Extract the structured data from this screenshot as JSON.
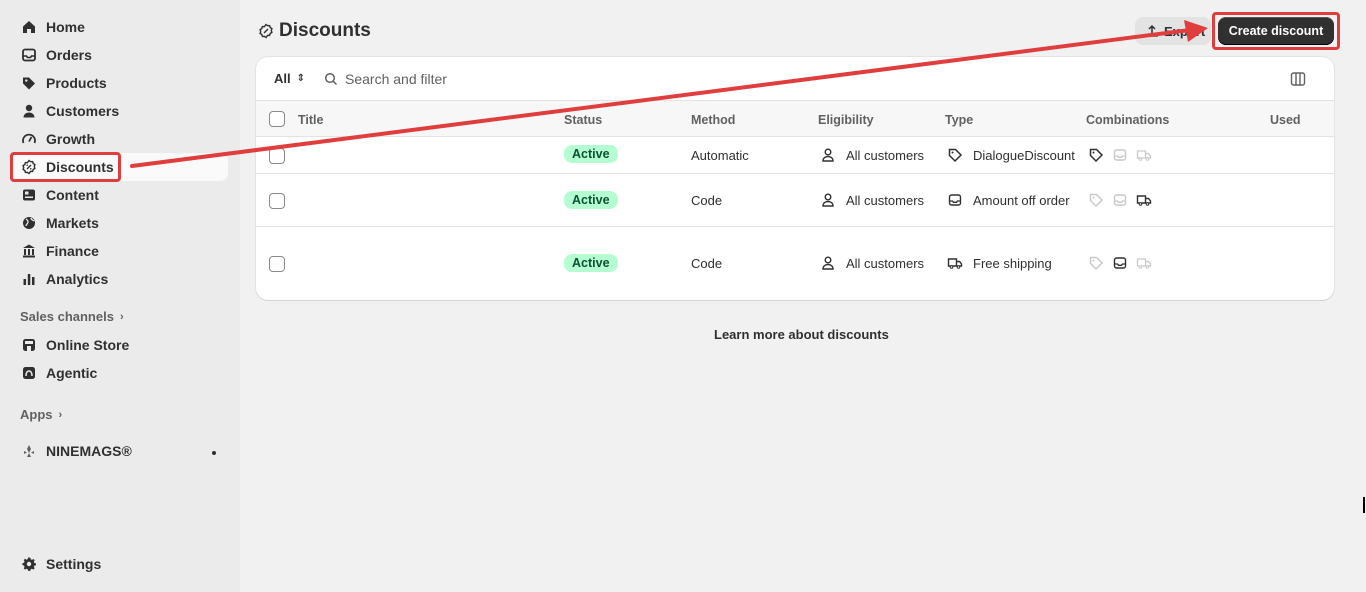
{
  "sidebar": {
    "items": [
      {
        "label": "Home",
        "icon": "home-icon"
      },
      {
        "label": "Orders",
        "icon": "inbox-icon"
      },
      {
        "label": "Products",
        "icon": "tag-icon"
      },
      {
        "label": "Customers",
        "icon": "person-icon"
      },
      {
        "label": "Growth",
        "icon": "gauge-icon"
      },
      {
        "label": "Discounts",
        "icon": "discount-icon"
      },
      {
        "label": "Content",
        "icon": "content-icon"
      },
      {
        "label": "Markets",
        "icon": "globe-icon"
      },
      {
        "label": "Finance",
        "icon": "bank-icon"
      },
      {
        "label": "Analytics",
        "icon": "bar-chart-icon"
      }
    ],
    "sales_channels_label": "Sales channels",
    "channels": [
      {
        "label": "Online Store",
        "icon": "store-icon"
      },
      {
        "label": "Agentic",
        "icon": "agentic-icon"
      }
    ],
    "apps_label": "Apps",
    "app_item": {
      "label": "NINEMAGS®",
      "icon": "app-icon"
    },
    "settings_label": "Settings"
  },
  "header": {
    "title": "Discounts",
    "export_label": "Export",
    "create_label": "Create discount"
  },
  "filter": {
    "all_label": "All",
    "search_placeholder": "Search and filter"
  },
  "table": {
    "columns": [
      "Title",
      "Status",
      "Method",
      "Eligibility",
      "Type",
      "Combinations",
      "Used"
    ],
    "rows": [
      {
        "title": "",
        "status": "Active",
        "method": "Automatic",
        "eligibility": "All customers",
        "type": "DialogueDiscount",
        "type_icon": "tag-icon",
        "combos": [
          "product",
          "order-off",
          "shipping-off"
        ]
      },
      {
        "title": "",
        "status": "Active",
        "method": "Code",
        "eligibility": "All customers",
        "type": "Amount off order",
        "type_icon": "inbox-icon",
        "combos": [
          "product-off",
          "order-off",
          "shipping"
        ]
      },
      {
        "title": "",
        "status": "Active",
        "method": "Code",
        "eligibility": "All customers",
        "type": "Free shipping",
        "type_icon": "truck-icon",
        "combos": [
          "product-off",
          "order",
          "shipping-off"
        ]
      }
    ]
  },
  "footer": {
    "learn_more": "Learn more about discounts"
  },
  "colors": {
    "annotation": "#e03e3e",
    "active_badge_bg": "#b4fed2",
    "primary_button": "#303030"
  }
}
